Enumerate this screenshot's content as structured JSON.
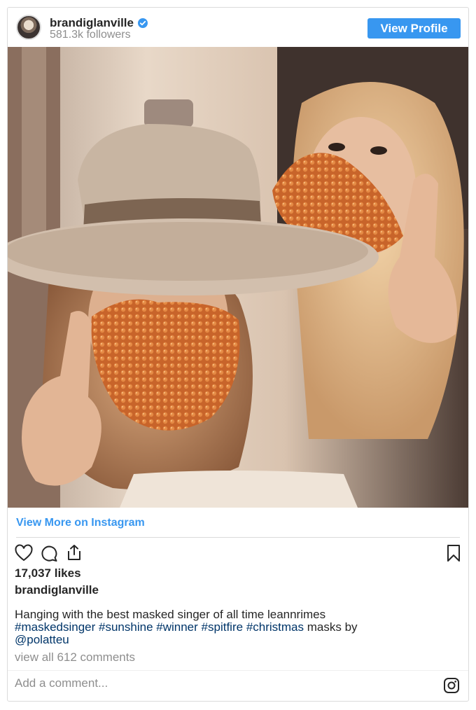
{
  "header": {
    "username": "brandiglanville",
    "followers": "581.3k followers",
    "view_profile_label": "View Profile",
    "verified_icon": "verified-badge-icon",
    "accent_color": "#3897f0"
  },
  "post": {
    "photo_alt": "brandiglanville post photo",
    "view_more_label": "View More on Instagram",
    "likes": "17,037 likes",
    "owner": "brandiglanville",
    "caption_text": "Hanging with the best masked singer of all time leannrimes",
    "hashtags": [
      "#maskedsinger",
      "#sunshine",
      "#winner",
      "#spitfire",
      "#christmas"
    ],
    "caption_after_tags": "masks by",
    "mention": "@polatteu",
    "comments_link": "view all 612 comments",
    "comment_placeholder": "Add a comment..."
  },
  "icons": {
    "like": "heart-icon",
    "comment": "comment-bubble-icon",
    "share": "share-icon",
    "save": "bookmark-icon",
    "instagram": "instagram-logo-icon"
  }
}
